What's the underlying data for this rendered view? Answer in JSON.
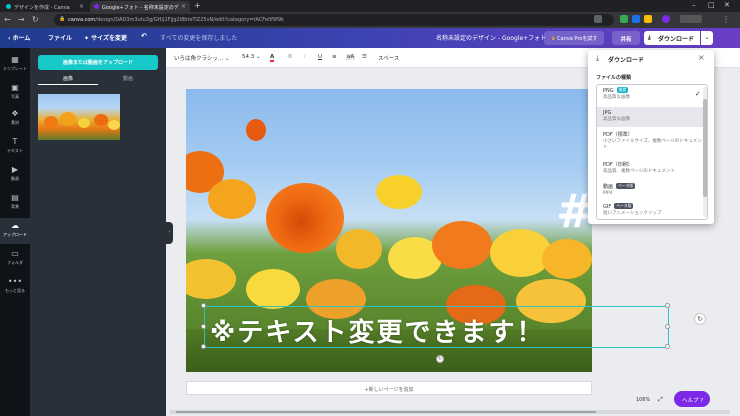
{
  "browser": {
    "tabs": [
      {
        "label": "デザインを作成 - Canva",
        "favicon_color": "#00c4cc"
      },
      {
        "label": "Google+フォト - 名称未設定のデ",
        "favicon_color": "#7d2ae8"
      }
    ],
    "new_tab": "+",
    "address": {
      "host": "canva.com",
      "path": "/design/DAD3m3utu3g/GH/j1Fjjg2l8bteTiZ25vN/edit?category=tACFe0f9f9k"
    },
    "window_controls": [
      "–",
      "□",
      "✕"
    ]
  },
  "header": {
    "home": "ホーム",
    "file": "ファイル",
    "resize": "サイズを変更",
    "undo_icon": "undo-icon",
    "save_status": "すべての変更を保存しました",
    "doc_title": "名称未設定のデザイン - Google+フォト",
    "pro_button": "Canva Proを試す",
    "share_button": "共有",
    "download_button": "ダウンロード"
  },
  "sidebar": {
    "items": [
      {
        "label": "テンプレート",
        "icon": "▦"
      },
      {
        "label": "写真",
        "icon": "▣"
      },
      {
        "label": "素材",
        "icon": "❖"
      },
      {
        "label": "テキスト",
        "icon": "T"
      },
      {
        "label": "動画",
        "icon": "▶"
      },
      {
        "label": "背景",
        "icon": "▤"
      },
      {
        "label": "アップロード",
        "icon": "☁"
      },
      {
        "label": "フォルダ",
        "icon": "▭"
      },
      {
        "label": "もっと見る",
        "icon": "•••"
      }
    ]
  },
  "panel": {
    "upload_button": "画像または動画をアップロード",
    "tabs": [
      "画像",
      "動画"
    ]
  },
  "toolbar": {
    "font": "いろは角クラシッ...",
    "font_size": "54.3",
    "text_color_icon": "A",
    "bold": "B",
    "italic": "I",
    "underline": "U",
    "align_icon": "≡",
    "case": "aA",
    "list_icon": "☰",
    "spacing": "スペース"
  },
  "canvas": {
    "overlay_text": "※テキスト変更できます！",
    "hash_text": "#"
  },
  "editor": {
    "add_page": "+新しいページを追加",
    "zoom": "106%",
    "help": "ヘルプ ?"
  },
  "download_panel": {
    "title": "ダウンロード",
    "file_type_label": "ファイルの種類",
    "options": [
      {
        "name": "PNG",
        "badge": "推奨",
        "badge_color": "#17b4c9",
        "desc": "高品質な画像",
        "checked": true
      },
      {
        "name": "JPG",
        "desc": "高品質な画像"
      },
      {
        "name": "PDF（標準）",
        "desc": "小さいファイルサイズ、複数ページのドキュメント"
      },
      {
        "name": "PDF（印刷）",
        "desc": "高品質、複数ページのドキュメント"
      },
      {
        "name": "動画",
        "badge": "ベータ版",
        "badge_color": "#4f5560",
        "desc": "MP4"
      },
      {
        "name": "GIF",
        "badge": "ベータ版",
        "badge_color": "#4f5560",
        "desc": "短いアニメーションクリップ"
      }
    ]
  },
  "colors": {
    "brand_purple": "#7d2ae8",
    "accent_teal": "#17c9c9",
    "header_gradient": [
      "#1f3b8c",
      "#6a3dc4"
    ]
  }
}
